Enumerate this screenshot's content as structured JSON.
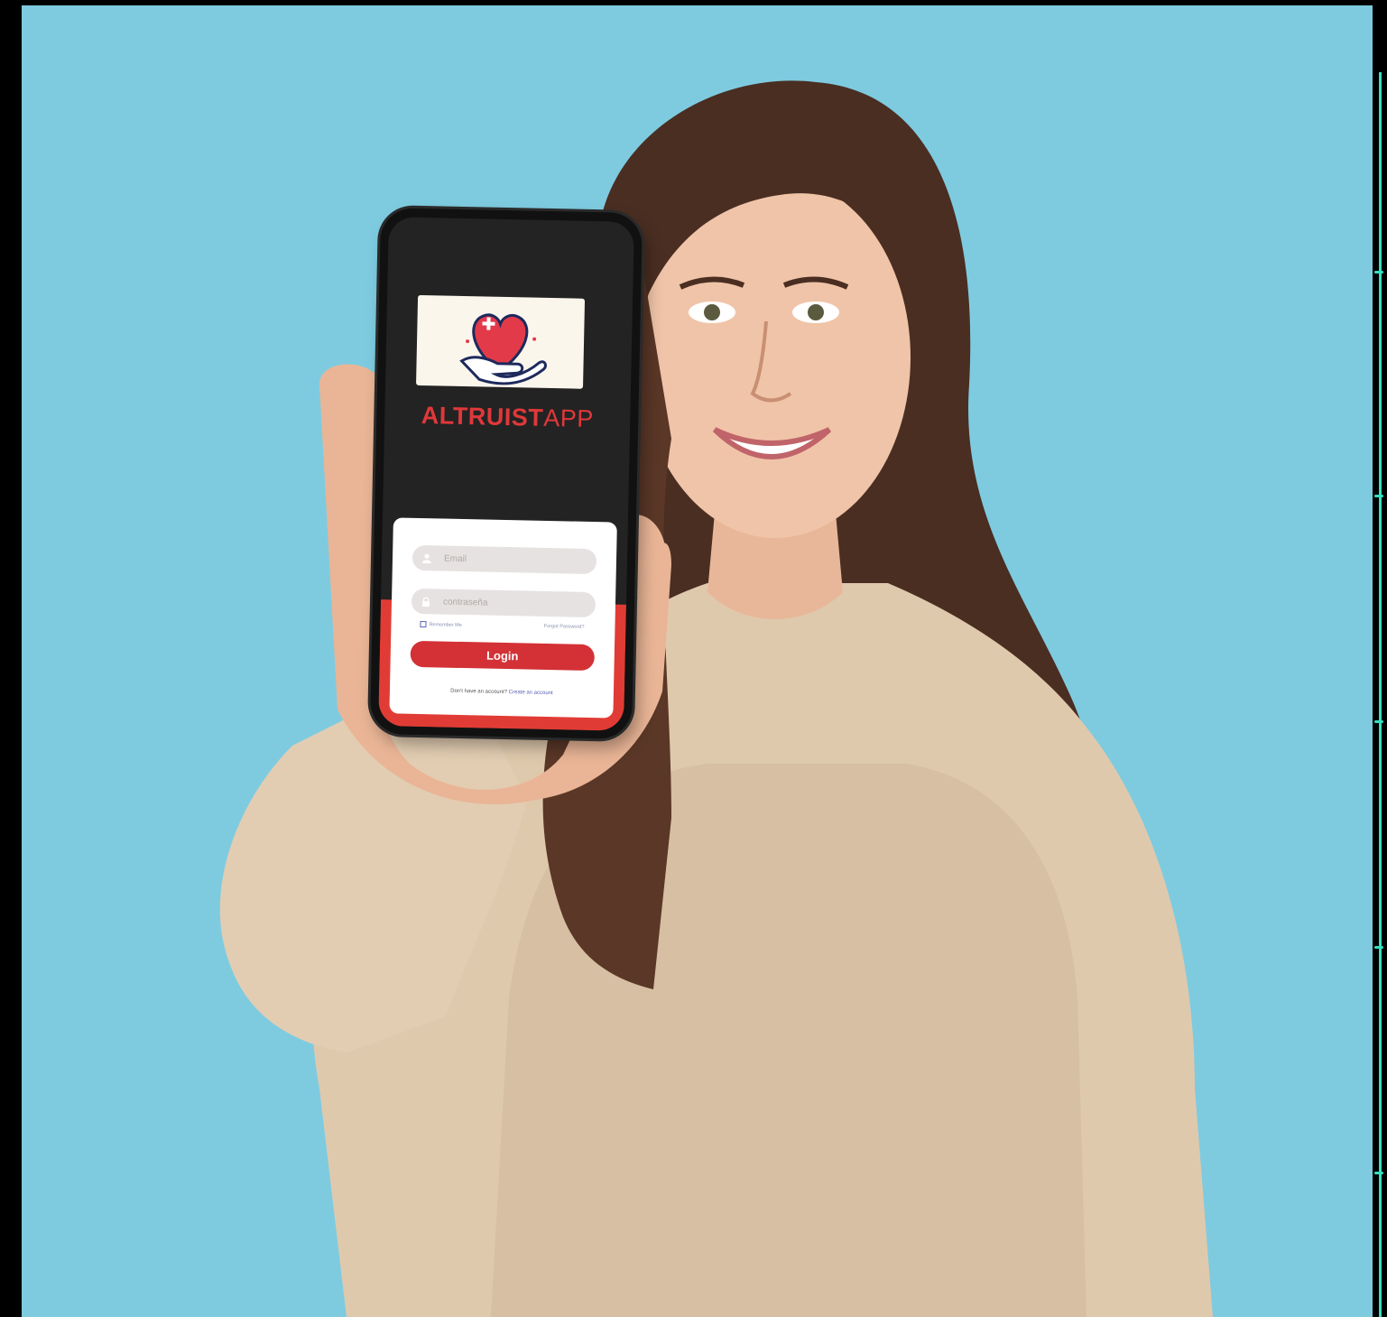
{
  "app": {
    "brand_bold": "ALTRUIST",
    "brand_light": "APP"
  },
  "login_form": {
    "email_placeholder": "Email",
    "password_placeholder": "contraseña",
    "remember_label": "Remember Me",
    "forgot_label": "Forgot Password?",
    "login_button": "Login",
    "no_account_text": "Don't have an account?",
    "create_account_link": "Create an account"
  },
  "icons": {
    "logo": "heart-in-hand-icon",
    "email": "user-icon",
    "password": "lock-icon"
  },
  "colors": {
    "background": "#7ecbe0",
    "brand_red": "#e0383a",
    "button_red": "#d33136",
    "phone_screen": "#232323",
    "accent_teal": "#35e0bf"
  }
}
